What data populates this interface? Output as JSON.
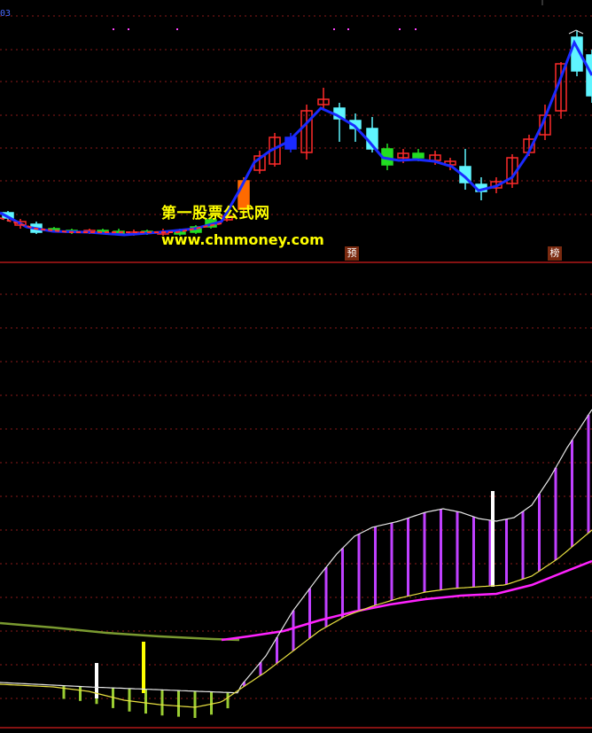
{
  "header": {
    "code_fragment": "03"
  },
  "watermark": {
    "line1": "第一股票公式网",
    "line2": "www.chnmoney.com"
  },
  "badges": [
    {
      "label": "预"
    },
    {
      "label": "榜"
    }
  ],
  "colors": {
    "background": "#000000",
    "grid": "#8b1a1a",
    "up_candle": "#ff2a2a",
    "down_candle_cyan": "#5ff5ff",
    "down_candle_green": "#22dd22",
    "ma_line": "#1a2aff",
    "watermark": "#ffff00",
    "osc_bar": "#c040ff",
    "magenta_line": "#ff22ff",
    "olive_line": "#7a9a30",
    "white_line": "#e8e8e8"
  }
}
